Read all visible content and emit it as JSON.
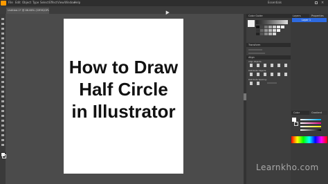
{
  "menubar": {
    "items": [
      "File",
      "Edit",
      "Object",
      "Type",
      "Select",
      "Effect",
      "View",
      "Window",
      "Help"
    ],
    "right_label": "Essentials"
  },
  "document": {
    "tab_title": "Untitled-1* @ 66.66% (CMYK/GPU Preview)"
  },
  "artboard": {
    "lines": [
      "How to Draw",
      "Half  Circle",
      "in Illustrator"
    ]
  },
  "panels": {
    "swatches_title": "Color Guide",
    "transform_title": "Transform",
    "align_title": "Align",
    "align_objects_label": "Align Objects:",
    "distribute_objects_label": "Distribute Objects:",
    "distribute_spacing_label": "Distribute Spacing:",
    "layers_tab": "Layers",
    "properties_tab": "Properties",
    "layer_name": "Layer 1",
    "color_title": "Color",
    "gradient_title": "Gradient"
  },
  "watermark": "Learnkho.com"
}
